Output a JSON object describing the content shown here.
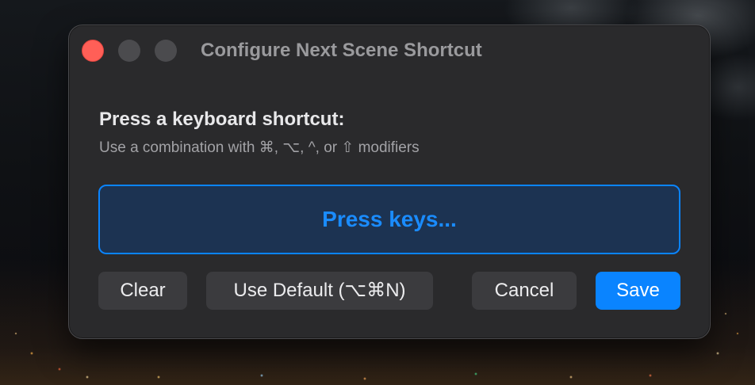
{
  "window": {
    "title": "Configure Next Scene Shortcut"
  },
  "traffic_lights": {
    "close": "#ff5f57",
    "minimize": "#4b4b4e",
    "maximize": "#4b4b4e"
  },
  "prompt": {
    "heading": "Press a keyboard shortcut:",
    "hint": "Use a combination with ⌘, ⌥, ^, or ⇧ modifiers"
  },
  "recorder": {
    "placeholder": "Press keys..."
  },
  "buttons": {
    "clear": "Clear",
    "use_default": "Use Default (⌥⌘N)",
    "cancel": "Cancel",
    "save": "Save"
  },
  "colors": {
    "accent": "#0a84ff",
    "window_bg": "#2a2a2c",
    "button_bg": "#3b3b3e"
  }
}
